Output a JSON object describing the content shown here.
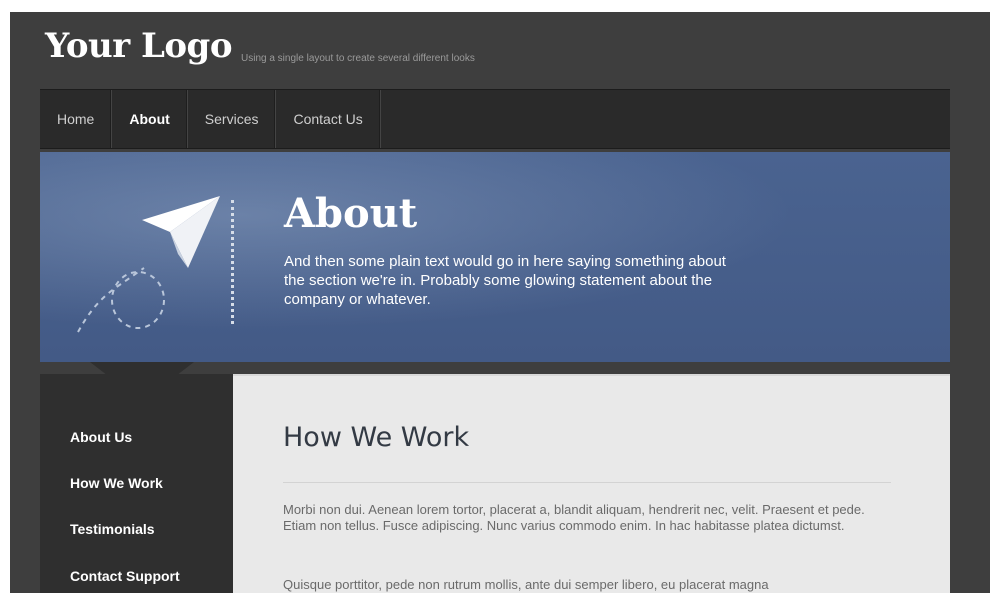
{
  "header": {
    "logo": "Your Logo",
    "tagline": "Using a single layout to create several different looks"
  },
  "nav": {
    "items": [
      {
        "label": "Home"
      },
      {
        "label": "About"
      },
      {
        "label": "Services"
      },
      {
        "label": "Contact Us"
      }
    ],
    "active": "About"
  },
  "hero": {
    "title": "About",
    "text": "And then some plain text would go in here saying something about the section we're in. Probably some glowing statement about the company or whatever.",
    "icon": "paper-plane-icon"
  },
  "sidebar": {
    "items": [
      {
        "label": "About Us"
      },
      {
        "label": "How We Work"
      },
      {
        "label": "Testimonials"
      },
      {
        "label": "Contact Support"
      }
    ]
  },
  "content": {
    "heading": "How We Work",
    "paragraphs": [
      "Morbi non dui. Aenean lorem tortor, placerat a, blandit aliquam, hendrerit nec, velit. Praesent et pede. Etiam non tellus. Fusce adipiscing. Nunc varius commodo enim. In hac habitasse platea dictumst.",
      "Quisque porttitor, pede non rutrum mollis, ante dui semper libero, eu placerat magna"
    ]
  },
  "colors": {
    "frame_bg": "#3e3e3e",
    "nav_bg": "#2a2a2a",
    "hero_bg": "#4a6390",
    "content_bg": "#e9e9e9",
    "sidebar_bg": "#2f2f2f"
  }
}
